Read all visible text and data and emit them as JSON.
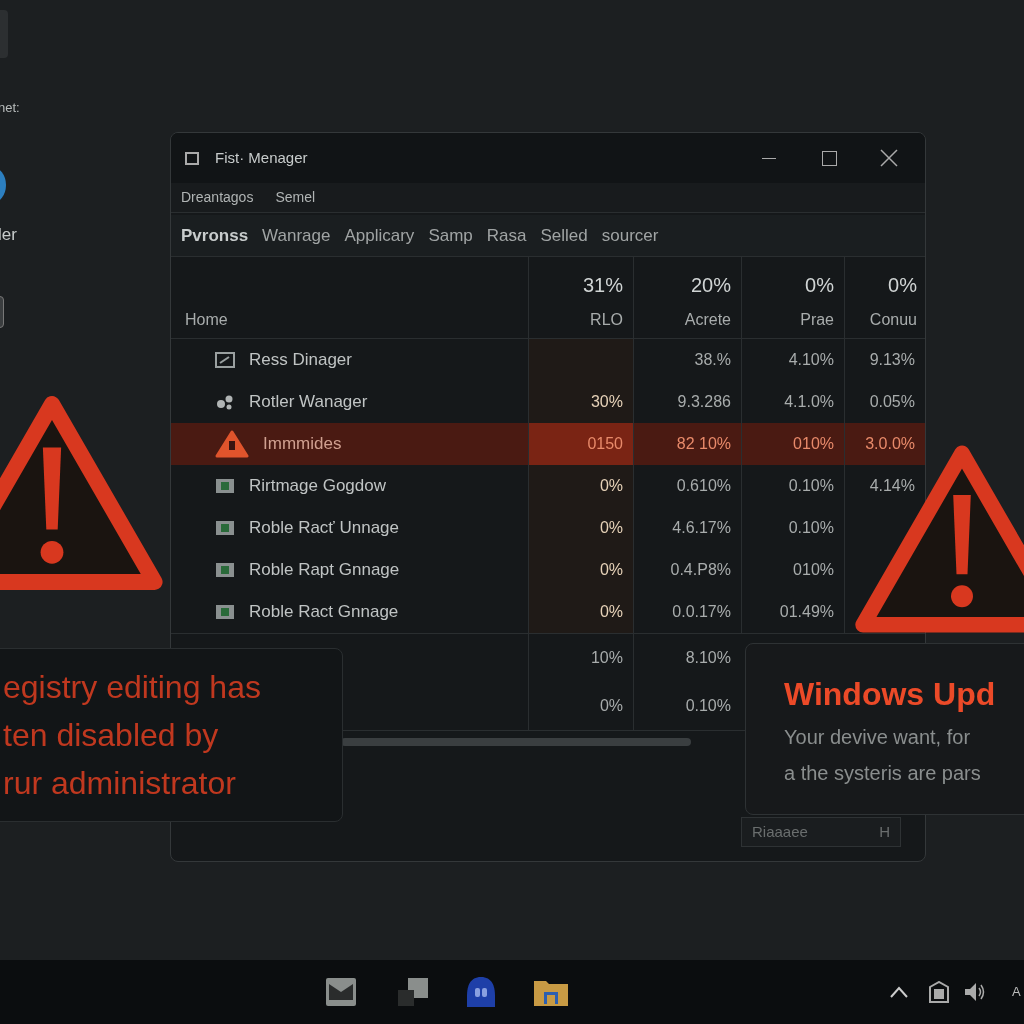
{
  "desktop_icons": [
    {
      "label": "net:"
    },
    {
      "label": "ler"
    }
  ],
  "window": {
    "title": "Fist· Menager",
    "menu": [
      "Dreantagos",
      "Semel"
    ],
    "tabs": [
      {
        "label": "Pvronss",
        "selected": true
      },
      {
        "label": "Wanrage",
        "selected": false
      },
      {
        "label": "Applicary",
        "selected": false
      },
      {
        "label": "Samp",
        "selected": false
      },
      {
        "label": "Rasa",
        "selected": false
      },
      {
        "label": "Selled",
        "selected": false
      },
      {
        "label": "sourcer",
        "selected": false
      }
    ],
    "name_column": "Home",
    "columns": [
      {
        "percent": "31%",
        "label": "RLO"
      },
      {
        "percent": "20%",
        "label": "Acrete"
      },
      {
        "percent": "0%",
        "label": "Prae"
      },
      {
        "percent": "0%",
        "label": "Conuu"
      }
    ],
    "rows": [
      {
        "kind": "window",
        "name": "Ress Dinager",
        "cells": {
          "col_2": "38.%",
          "col_3": "4.10%",
          "col_4": "9.13%"
        },
        "selected": false
      },
      {
        "kind": "gears",
        "name": "Rotler Wanager",
        "cells": {
          "col_1": "30%",
          "col_2": "9.3.286",
          "col_3": "4.1.0%",
          "col_4": "0.05%"
        },
        "selected": false
      },
      {
        "kind": "warning",
        "name": "Immmides",
        "cells": {
          "col_1": "0150",
          "col_2": "82 10%",
          "col_3": "010%",
          "col_4": "3.0.0%"
        },
        "selected": true
      },
      {
        "kind": "app",
        "name": "Rirtmage Gogdow",
        "cells": {
          "col_1": "0%",
          "col_2": "0.610%",
          "col_3": "0.10%",
          "col_4": "4.14%"
        },
        "selected": false
      },
      {
        "kind": "app",
        "name": "Roble Racť Unnage",
        "cells": {
          "col_1": "0%",
          "col_2": "4.6.17%",
          "col_3": "0.10%"
        },
        "selected": false
      },
      {
        "kind": "app",
        "name": "Roble Rapt Gnnage",
        "cells": {
          "col_1": "0%",
          "col_2": "0.4.P8%",
          "col_3": "010%"
        },
        "selected": false
      },
      {
        "kind": "app",
        "name": "Roble Ract Gnnage",
        "cells": {
          "col_1": "0%",
          "col_2": "0.0.17%",
          "col_3": "01.49%"
        },
        "selected": false
      }
    ],
    "summary_rows": [
      [
        "10%",
        "8.10%"
      ],
      [
        "0%",
        "0.10%"
      ]
    ],
    "footer_button": "Riaaaee",
    "footer_key": "H"
  },
  "notifications": [
    {
      "kind": "error",
      "lines": [
        "egistry editing has",
        "ten disabled by",
        "rur administrator"
      ]
    },
    {
      "kind": "update",
      "title": "Windows Upd",
      "lines": [
        "Your devive want, for",
        "a the systeris are pars"
      ]
    }
  ],
  "tray_text": "A"
}
